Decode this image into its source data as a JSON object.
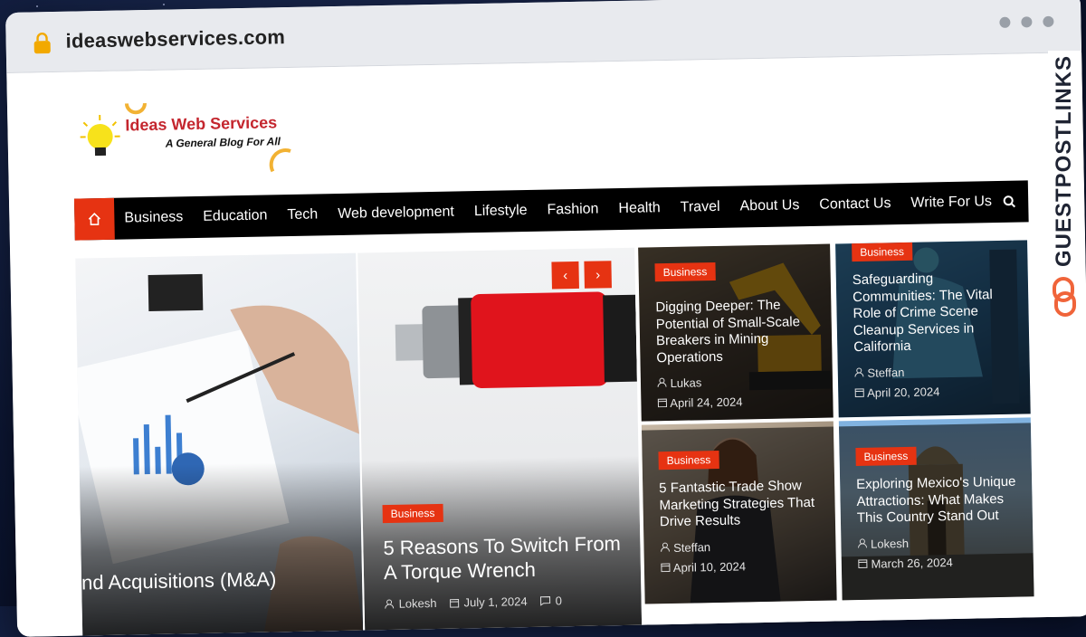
{
  "browser": {
    "url": "ideaswebservices.com"
  },
  "logo": {
    "title": "Ideas Web Services",
    "tagline": "A General Blog For All"
  },
  "nav": {
    "items": [
      "Business",
      "Education",
      "Tech",
      "Web development",
      "Lifestyle",
      "Fashion",
      "Health",
      "Travel",
      "About Us",
      "Contact Us",
      "Write For Us"
    ]
  },
  "hero": [
    {
      "title": "nd Acquisitions (M&A)"
    },
    {
      "category": "Business",
      "title": "5 Reasons To Switch From A Torque Wrench",
      "author": "Lokesh",
      "date": "July 1, 2024",
      "comments": "0"
    }
  ],
  "cards": [
    {
      "category": "Business",
      "title": "Digging Deeper: The Potential of Small-Scale Breakers in Mining Operations",
      "author": "Lukas",
      "date": "April 24, 2024"
    },
    {
      "category": "Business",
      "title": "Safeguarding Communities: The Vital Role of Crime Scene Cleanup Services in California",
      "author": "Steffan",
      "date": "April 20, 2024"
    },
    {
      "category": "Business",
      "title": "5 Fantastic Trade Show Marketing Strategies That Drive Results",
      "author": "Steffan",
      "date": "April 10, 2024"
    },
    {
      "category": "Business",
      "title": "Exploring Mexico's Unique Attractions: What Makes This Country Stand Out",
      "author": "Lokesh",
      "date": "March 26, 2024"
    }
  ],
  "watermark": "GUESTPOSTLINKS",
  "colors": {
    "accent": "#e63312",
    "nav_bg": "#000000",
    "logo_red": "#c4262e"
  }
}
